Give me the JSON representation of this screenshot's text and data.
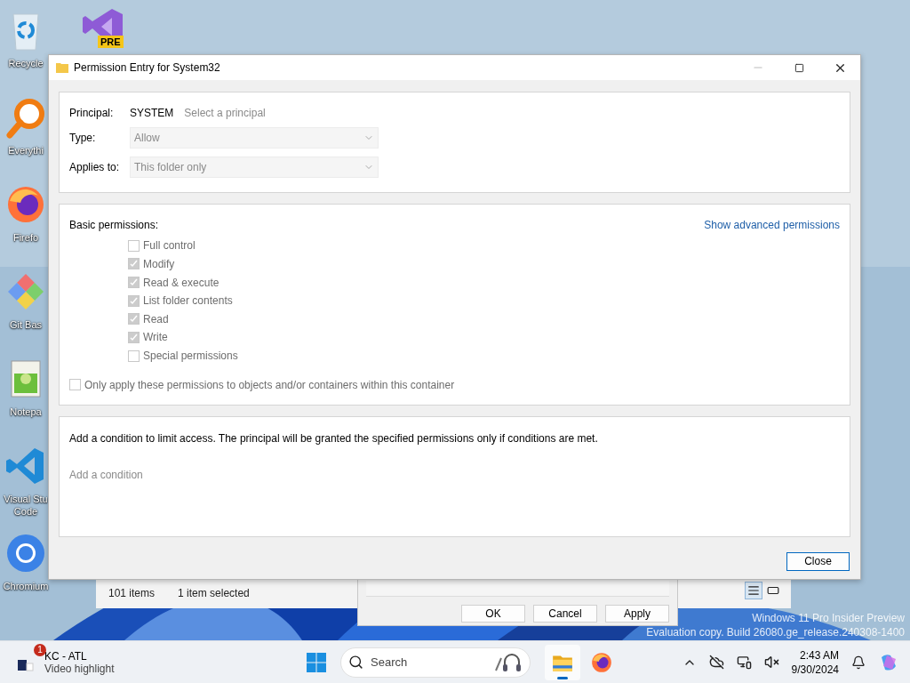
{
  "desktop_icons": [
    {
      "kind": "recycle",
      "label": "Recycle"
    },
    {
      "kind": "everything",
      "label": "Everythi"
    },
    {
      "kind": "firefox",
      "label": "Firefo"
    },
    {
      "kind": "git",
      "label": "Git Bas"
    },
    {
      "kind": "notepad",
      "label": "Notepa"
    },
    {
      "kind": "vscode",
      "label": "Visual Stu\nCode"
    },
    {
      "kind": "chromium",
      "label": "Chromium"
    }
  ],
  "pinned_icon": {
    "kind": "vs-preview",
    "badge": "PRE"
  },
  "explorer_status": {
    "items": "101 items",
    "selection": "1 item selected",
    "views": [
      {
        "kind": "details",
        "selected": true
      },
      {
        "kind": "tiles",
        "selected": false
      }
    ]
  },
  "properties_buttons": [
    "OK",
    "Cancel",
    "Apply"
  ],
  "watermark": [
    "Windows 11 Pro Insider Preview",
    "Evaluation copy. Build 26080.ge_release.240308-1400"
  ],
  "dialog": {
    "title": "Permission Entry for System32",
    "principal": {
      "label": "Principal:",
      "value": "SYSTEM",
      "link": "Select a principal"
    },
    "type": {
      "label": "Type:",
      "value": "Allow",
      "disabled": true
    },
    "applies_to": {
      "label": "Applies to:",
      "value": "This folder only",
      "disabled": true
    },
    "basic_permissions": {
      "label": "Basic permissions:",
      "link": "Show advanced permissions",
      "items": [
        {
          "label": "Full control",
          "checked": false,
          "disabled": true
        },
        {
          "label": "Modify",
          "checked": true,
          "disabled": true
        },
        {
          "label": "Read & execute",
          "checked": true,
          "disabled": true
        },
        {
          "label": "List folder contents",
          "checked": true,
          "disabled": true
        },
        {
          "label": "Read",
          "checked": true,
          "disabled": true
        },
        {
          "label": "Write",
          "checked": true,
          "disabled": true
        },
        {
          "label": "Special permissions",
          "checked": false,
          "disabled": true
        }
      ]
    },
    "only_apply": {
      "label": "Only apply these permissions to objects and/or containers within this container",
      "checked": false,
      "disabled": true
    },
    "condition": {
      "text": "Add a condition to limit access. The principal will be granted the specified permissions only if conditions are met.",
      "link": "Add a condition"
    },
    "buttons": [
      "Close"
    ]
  },
  "taskbar": {
    "widget": {
      "badge": "1",
      "title": "KC - ATL",
      "subtitle": "Video highlight"
    },
    "search": {
      "placeholder": "Search"
    },
    "apps": [
      {
        "kind": "explorer",
        "running": true
      },
      {
        "kind": "firefox",
        "running": false
      }
    ],
    "clock": {
      "time": "2:43 AM",
      "date": "9/30/2024"
    }
  }
}
